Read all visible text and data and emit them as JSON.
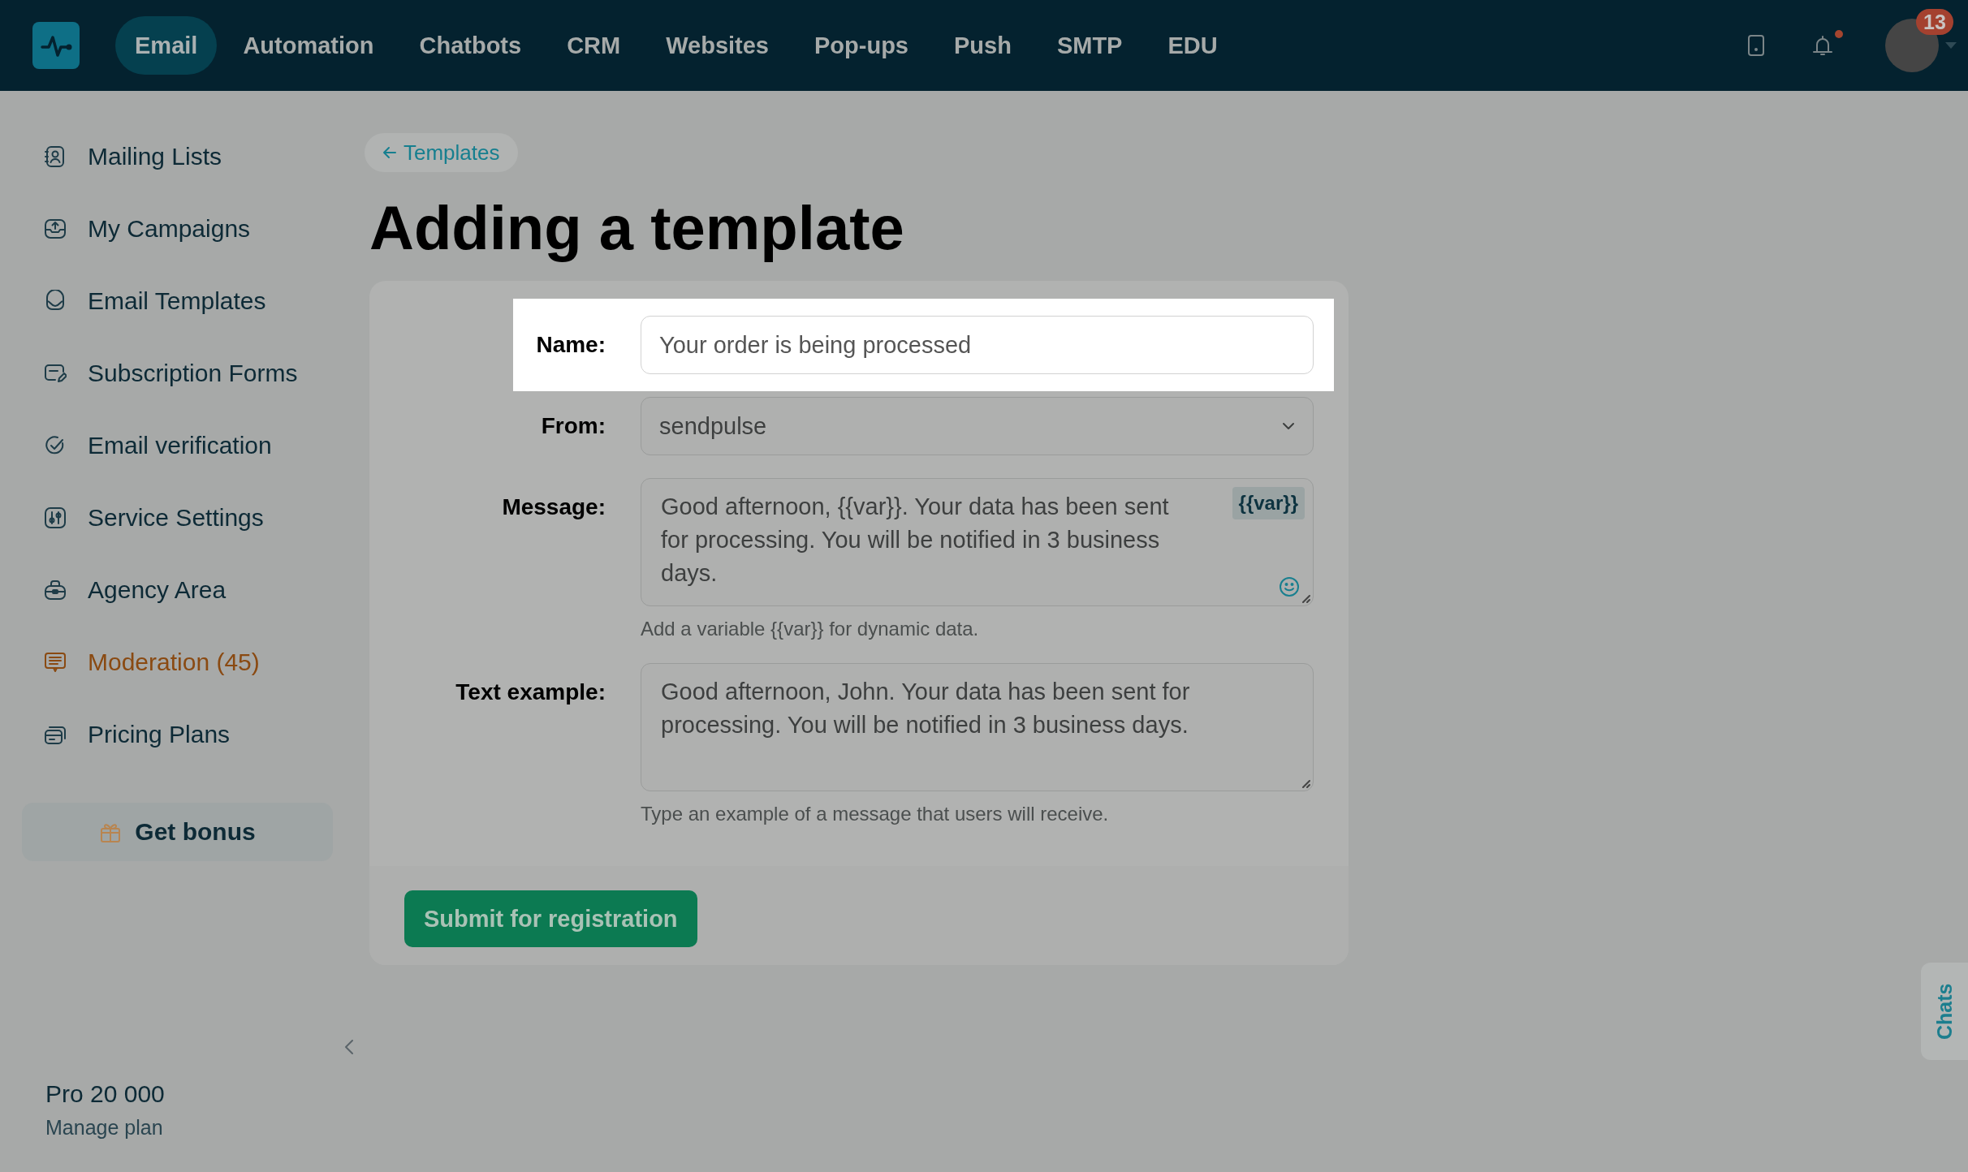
{
  "nav": {
    "items": [
      {
        "label": "Email",
        "selected": true
      },
      {
        "label": "Automation",
        "selected": false
      },
      {
        "label": "Chatbots",
        "selected": false
      },
      {
        "label": "CRM",
        "selected": false
      },
      {
        "label": "Websites",
        "selected": false
      },
      {
        "label": "Pop-ups",
        "selected": false
      },
      {
        "label": "Push",
        "selected": false
      },
      {
        "label": "SMTP",
        "selected": false
      },
      {
        "label": "EDU",
        "selected": false
      }
    ],
    "bell": {
      "unread": true
    },
    "avatar_badge": "13"
  },
  "sidebar": {
    "items": [
      {
        "label": "Mailing Lists",
        "highlighted": false
      },
      {
        "label": "My Campaigns",
        "highlighted": false
      },
      {
        "label": "Email Templates",
        "highlighted": false
      },
      {
        "label": "Subscription Forms",
        "highlighted": false
      },
      {
        "label": "Email verification",
        "highlighted": false
      },
      {
        "label": "Service Settings",
        "highlighted": false
      },
      {
        "label": "Agency Area",
        "highlighted": false
      },
      {
        "label": "Moderation (45)",
        "highlighted": true
      },
      {
        "label": "Pricing Plans",
        "highlighted": false
      }
    ],
    "bonus_button": "Get bonus",
    "plan": {
      "name": "Pro 20 000",
      "link": "Manage plan"
    }
  },
  "breadcrumb": "Templates",
  "title": "Adding a template",
  "form": {
    "fields": [
      {
        "kind": "input",
        "label": "Name:",
        "value": "Your order is being processed",
        "highlighted": true
      },
      {
        "kind": "select",
        "label": "From:",
        "value": "sendpulse",
        "highlighted": false
      },
      {
        "kind": "textarea",
        "label": "Message:",
        "value": "Good afternoon, {{var}}. Your data has been sent for processing. You will be notified in 3 business days.",
        "variable_button": "{{var}}",
        "hint": "Add a variable {{var}} for dynamic data.",
        "highlighted": false
      },
      {
        "kind": "textarea",
        "label": "Text example:",
        "value": "Good afternoon, John. Your data has been sent for processing. You will be notified in 3 business days.",
        "hint": "Type an example of a message that users will receive.",
        "highlighted": false
      }
    ],
    "submit_button": "Submit for registration"
  },
  "chats_tab": "Chats"
}
